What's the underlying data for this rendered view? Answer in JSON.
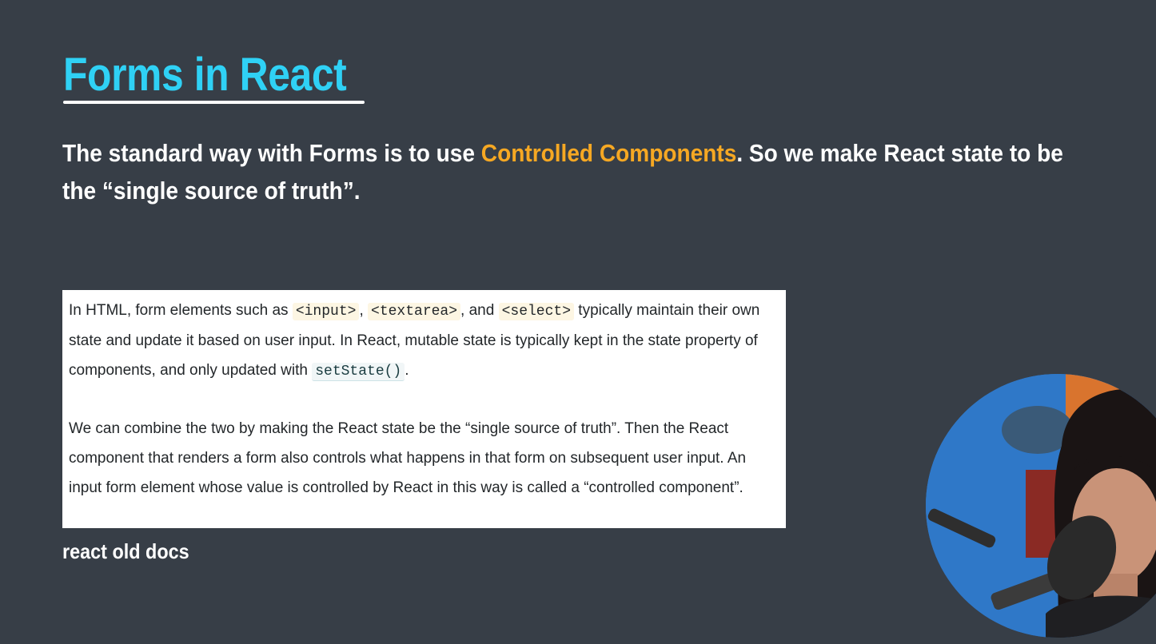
{
  "slide": {
    "title": "Forms in React",
    "lead": {
      "before": "The standard way with Forms is to use ",
      "highlight": "Controlled Components",
      "after": ". So we make React state to be the “single source of truth”."
    },
    "doc": {
      "p1": {
        "t1": "In HTML, form elements such as ",
        "c1": "<input>",
        "t2": ", ",
        "c2": "<textarea>",
        "t3": ", and ",
        "c3": "<select>",
        "t4": " typically maintain their own state and update it based on user input. In React, mutable state is typically kept in the state property of components, and only updated with ",
        "c4": "setState()",
        "t5": "."
      },
      "p2": "We can combine the two by making the React state be the “single source of truth”. Then the React component that renders a form also controls what happens in that form on subsequent user input. An input form element whose value is controlled by React in this way is called a “controlled component”."
    },
    "caption": "react old docs"
  },
  "colors": {
    "background": "#373e47",
    "title": "#2fd1f5",
    "highlight": "#f6a823",
    "text": "#ffffff"
  }
}
